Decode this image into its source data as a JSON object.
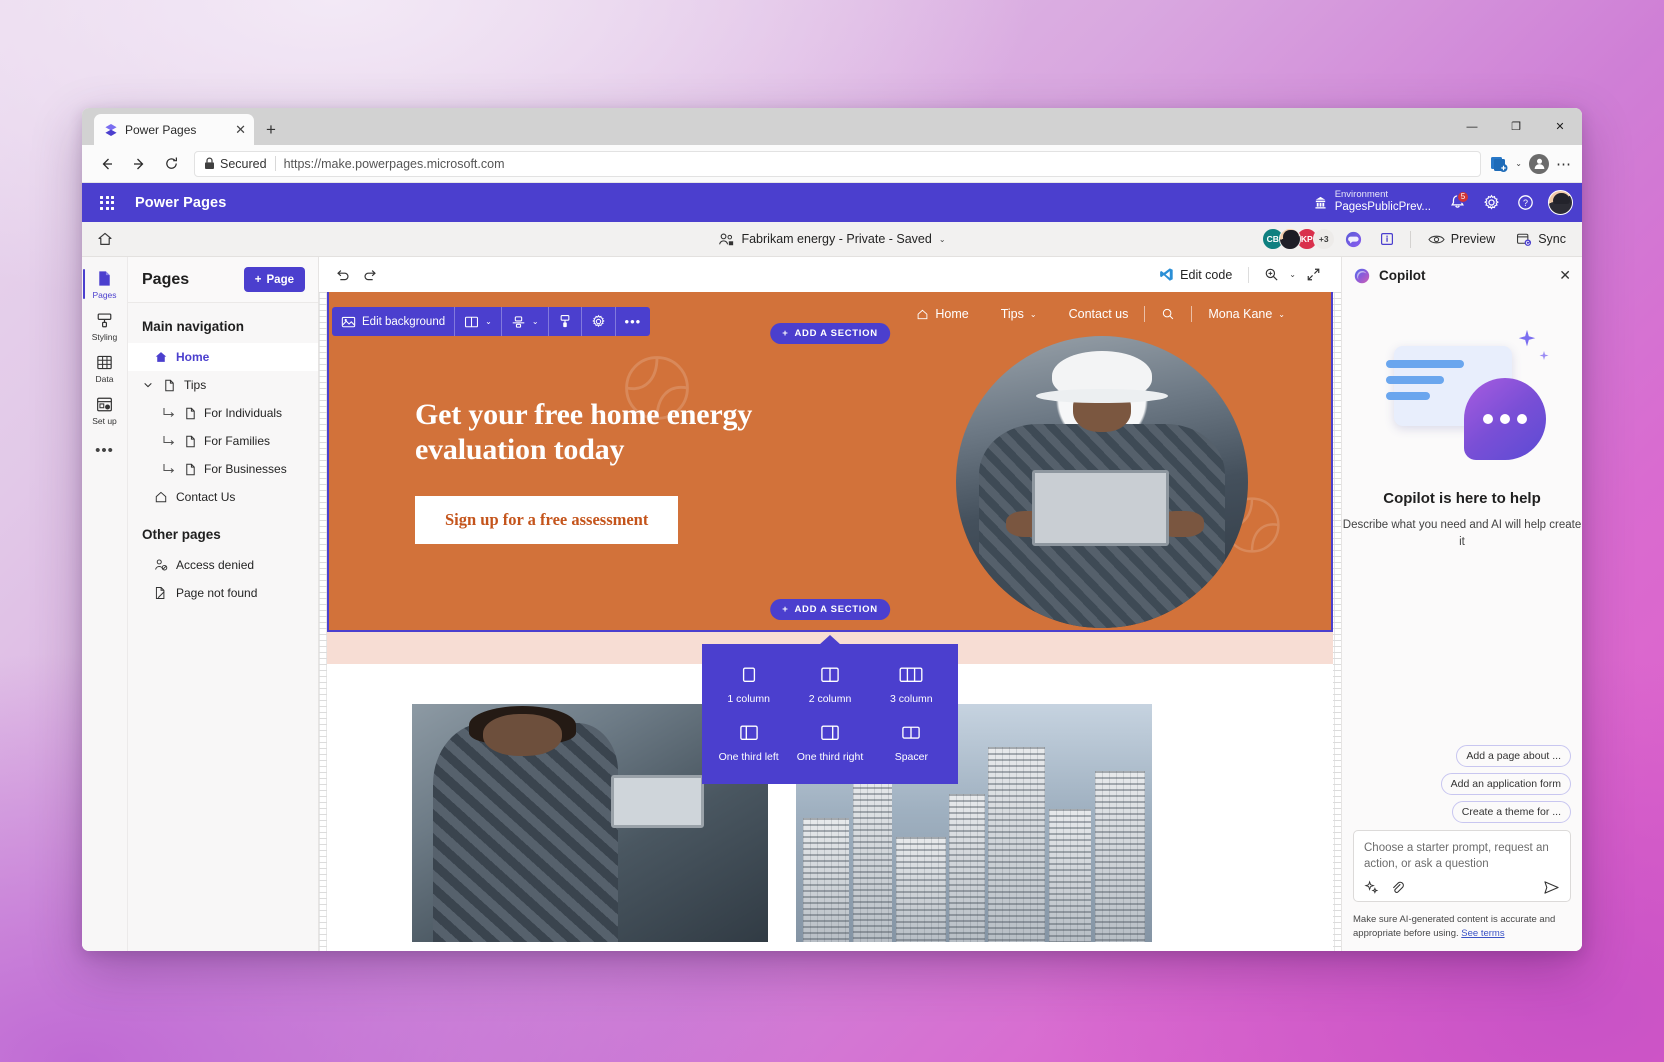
{
  "browser": {
    "tab": {
      "title": "Power Pages",
      "favicon": "power-pages-logo",
      "close": "✕"
    },
    "new_tab": "+",
    "window_controls": {
      "minimize": "—",
      "maximize": "❐",
      "close": "✕"
    },
    "nav": {
      "back": "←",
      "forward": "→",
      "reload": "↻"
    },
    "omnibox": {
      "security_label": "Secured",
      "url": "https://make.powerpages.microsoft.com"
    },
    "toolbar_right": {
      "collections": "collections-icon",
      "chevron": "⌄",
      "profile": "profile-avatar",
      "more": "⋯"
    }
  },
  "app_header": {
    "waffle": "app-launcher",
    "brand": "Power Pages",
    "environment_label": "Environment",
    "environment_name": "PagesPublicPrev...",
    "notifications_count": "5",
    "icons": {
      "environment": "environment-icon",
      "bell": "notifications-icon",
      "settings": "settings-gear-icon",
      "help": "?",
      "avatar": "user-avatar"
    }
  },
  "command_bar": {
    "home": "home-icon",
    "site_name": "Fabrikam energy - Private - Saved",
    "site_chevron": "⌄",
    "faces": [
      {
        "initials": "CB",
        "color": "#0f8080"
      },
      {
        "initials": "",
        "color": "photo"
      },
      {
        "initials": "KP",
        "color": "#d9304c"
      },
      {
        "initials": "+3",
        "color": "#edebe9"
      }
    ],
    "copilot_icon": "copilot-icon",
    "info_icon": "info-icon",
    "preview_label": "Preview",
    "sync_label": "Sync"
  },
  "rail": {
    "items": [
      {
        "label": "Pages",
        "icon": "pages-icon",
        "active": true
      },
      {
        "label": "Styling",
        "icon": "styling-icon",
        "active": false
      },
      {
        "label": "Data",
        "icon": "data-table-icon",
        "active": false
      },
      {
        "label": "Set up",
        "icon": "setup-icon",
        "active": false
      }
    ],
    "more": "•••"
  },
  "pages_panel": {
    "title": "Pages",
    "add_page_label": "Page",
    "add_page_plus": "+",
    "main_nav_title": "Main navigation",
    "main_nav": [
      {
        "label": "Home",
        "icon": "home-filled-icon",
        "selected": true,
        "level": 0,
        "chevron": ""
      },
      {
        "label": "Tips",
        "icon": "page-icon",
        "selected": false,
        "level": 0,
        "chevron": "⌄"
      },
      {
        "label": "For Individuals",
        "icon": "page-icon",
        "selected": false,
        "level": 1,
        "chevron": ""
      },
      {
        "label": "For Families",
        "icon": "page-icon",
        "selected": false,
        "level": 1,
        "chevron": ""
      },
      {
        "label": "For Businesses",
        "icon": "page-icon",
        "selected": false,
        "level": 1,
        "chevron": ""
      },
      {
        "label": "Contact Us",
        "icon": "home-outline-icon",
        "selected": false,
        "level": 0,
        "chevron": ""
      }
    ],
    "other_pages_title": "Other pages",
    "other_pages": [
      {
        "label": "Access denied",
        "icon": "access-denied-icon"
      },
      {
        "label": "Page not found",
        "icon": "page-not-found-icon"
      }
    ]
  },
  "canvas_toolbar": {
    "undo": "undo-icon",
    "redo": "redo-icon",
    "edit_code_label": "Edit code",
    "zoom_icon": "zoom-icon",
    "zoom_chevron": "⌄",
    "expand_icon": "expand-icon"
  },
  "editor_toolbar": {
    "edit_background_label": "Edit background",
    "items": [
      {
        "name": "columns-layout",
        "chevron": "⌄"
      },
      {
        "name": "alignment",
        "chevron": "⌄"
      },
      {
        "name": "theme-paint",
        "chevron": ""
      },
      {
        "name": "settings-gear",
        "chevron": ""
      },
      {
        "name": "more-options",
        "chevron": ""
      }
    ],
    "more_glyph": "•••"
  },
  "add_section": {
    "label": "ADD A SECTION",
    "plus": "+"
  },
  "layout_popup": {
    "options": [
      {
        "label": "1 column",
        "icon": "one-column-icon"
      },
      {
        "label": "2 column",
        "icon": "two-column-icon"
      },
      {
        "label": "3 column",
        "icon": "three-column-icon"
      },
      {
        "label": "One third left",
        "icon": "one-third-left-icon"
      },
      {
        "label": "One third right",
        "icon": "one-third-right-icon"
      },
      {
        "label": "Spacer",
        "icon": "spacer-icon"
      }
    ]
  },
  "site_preview": {
    "nav": [
      {
        "label": "Home",
        "icon": "home-outline-icon",
        "chevron": ""
      },
      {
        "label": "Tips",
        "icon": "",
        "chevron": "⌄"
      },
      {
        "label": "Contact us",
        "icon": "",
        "chevron": ""
      }
    ],
    "search_icon": "search-icon",
    "user_name": "Mona Kane",
    "user_chevron": "⌄",
    "hero_heading": "Get your free home energy evaluation today",
    "hero_cta": "Sign up for a free assessment",
    "hero_bg_color": "#d2723a",
    "hero_photo": "engineer-with-tablet-photo",
    "card_images": [
      "woman-with-tablet-photo",
      "city-buildings-photo"
    ]
  },
  "copilot": {
    "title": "Copilot",
    "close": "✕",
    "heading": "Copilot is here to help",
    "subtitle": "Describe what you need and AI will help create it",
    "chips": [
      "Add a page about ...",
      "Add an application form",
      "Create a theme for ..."
    ],
    "input_placeholder": "Choose a starter prompt, request an action, or ask a question",
    "input_icons": {
      "sparkle": "sparkle-icon",
      "attach": "attach-clip-icon",
      "send": "send-icon"
    },
    "disclaimer": "Make sure AI-generated content is accurate and appropriate before using.",
    "terms_link": "See terms"
  },
  "colors": {
    "brand_purple": "#4b3fce",
    "hero_orange": "#d2723a",
    "accent_red": "#d13438"
  }
}
